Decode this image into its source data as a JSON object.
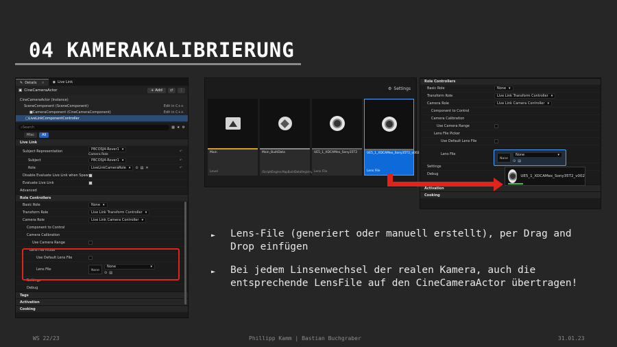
{
  "slide": {
    "title": "04 KAMERAKALIBRIERUNG",
    "bullets": [
      "Lens-File (generiert oder manuell erstellt), per Drag and Drop einfügen",
      "Bei jedem Linsenwechsel der realen Kamera, auch die entsprechende LensFile auf den CineCameraActor übertragen!"
    ],
    "footer": {
      "left": "WS 22/23",
      "center": "Phillipp Kamm | Bastian Buchgraber",
      "right": "31.01.23"
    }
  },
  "details": {
    "tabs": [
      {
        "label": "Details"
      },
      {
        "label": "Live Link"
      }
    ],
    "actor_name": "CineCameraActor",
    "add_label": "+ Add",
    "components": [
      {
        "label": "CineCameraActor (Instance)",
        "edit": ""
      },
      {
        "label": "SceneComponent (SceneComponent)",
        "edit": "Edit in C++"
      },
      {
        "label": "CameraComponent (CineCameraComponent)",
        "edit": "Edit in C++"
      },
      {
        "label": "LiveLinkComponentController",
        "edit": ""
      }
    ],
    "search_placeholder": "Search",
    "filters": {
      "misc": "Misc",
      "all": "All"
    },
    "sections": {
      "live_link": "Live Link",
      "advanced": "Advanced",
      "role_controllers": "Role Controllers",
      "tags": "Tags",
      "activation": "Activation",
      "cooking": "Cooking"
    },
    "props": {
      "subject_representation": "Subject Representation",
      "subject_rep_value1": "P8COSJ4-Rover1",
      "subject_rep_value2": "Camera Role",
      "subject": "Subject",
      "subject_value": "P8COSJ4-Rover1",
      "role": "Role",
      "role_value": "LiveLinkCameraRole",
      "disable_eval": "Disable Evaluate Live Link when Spawnable",
      "evaluate": "Evaluate Live Link",
      "basic_role": "Basic Role",
      "basic_role_value": "None",
      "transform_role": "Transform Role",
      "transform_role_value": "Live Link Transform Controller",
      "camera_role": "Camera Role",
      "camera_role_value": "Live Link Camera Controller",
      "component_to_control": "Component to Control",
      "camera_calibration": "Camera Calibration",
      "use_camera_range": "Use Camera Range",
      "lens_file_picker": "Lens File Picker",
      "use_default_lens_file": "Use Default Lens File",
      "lens_file": "Lens File",
      "lens_file_value": "None",
      "none_thumb": "None",
      "settings": "Settings",
      "debug": "Debug"
    }
  },
  "browser": {
    "settings_label": "Settings",
    "tiles": [
      {
        "name": "Main",
        "type": "Level",
        "path": ""
      },
      {
        "name": "Main_BuiltData",
        "type": "",
        "path": "/Script/Engine.MapBuildDataRegistry"
      },
      {
        "name": "UE5_1_XDCAMex_Sony35T2",
        "type": "Lens File",
        "path": ""
      },
      {
        "name": "UE5_1_XDCAMex_Sony35T2_v002",
        "type": "Lens File",
        "path": ""
      }
    ]
  },
  "rpanel": {
    "section_role_controllers": "Role Controllers",
    "basic_role": "Basic Role",
    "basic_role_value": "None",
    "transform_role": "Transform Role",
    "transform_role_value": "Live Link Transform Controller",
    "camera_role": "Camera Role",
    "camera_role_value": "Live Link Camera Controller",
    "component_to_control": "Component to Control",
    "camera_calibration": "Camera Calibration",
    "use_camera_range": "Use Camera Range",
    "lens_file_picker": "Lens File Picker",
    "use_default_lens_file": "Use Default Lens File",
    "lens_file": "Lens File",
    "lens_file_value": "None",
    "none_thumb": "None",
    "settings": "Settings",
    "debug": "Debug",
    "activation": "Activation",
    "cooking": "Cooking",
    "drag_chip_label": "UE5_1_XDCAMex_Sony35T2_v002"
  },
  "colors": {
    "accent_blue": "#0f6ad9",
    "highlight_red": "#e0231b",
    "lens_bar": "#d9a020"
  }
}
